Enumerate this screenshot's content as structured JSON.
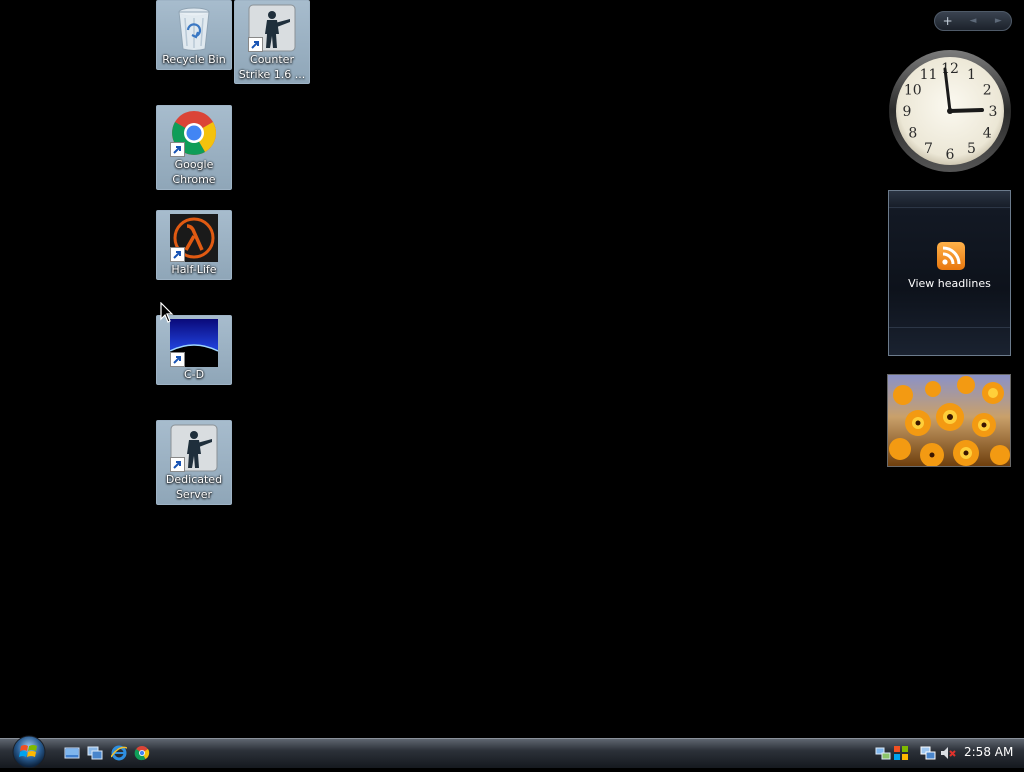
{
  "desktop": {
    "icons": [
      {
        "label": "Recycle Bin"
      },
      {
        "label": "Counter Strike 1.6 ..."
      },
      {
        "label": "Google Chrome"
      },
      {
        "label": "Half-Life"
      },
      {
        "label": "C-D"
      },
      {
        "label": "Dedicated Server"
      }
    ]
  },
  "sidebar": {
    "controls": {
      "add": "+",
      "prev": "◄",
      "next": "►"
    },
    "clock": {
      "numerals": [
        "12",
        "1",
        "2",
        "3",
        "4",
        "5",
        "6",
        "7",
        "8",
        "9",
        "10",
        "11"
      ]
    },
    "feed": {
      "label": "View headlines"
    }
  },
  "taskbar": {
    "clock": "2:58 AM",
    "quick_launch": [
      "show-desktop-icon",
      "switch-windows-icon",
      "internet-explorer-icon",
      "chrome-icon"
    ],
    "tray": [
      "network-icon",
      "windows-update-icon",
      "network-connection-icon",
      "volume-muted-icon"
    ]
  },
  "colors": {
    "desktop": "#000000",
    "icon_selection": "#9fb4c6",
    "taskbar": "#2c3139"
  }
}
